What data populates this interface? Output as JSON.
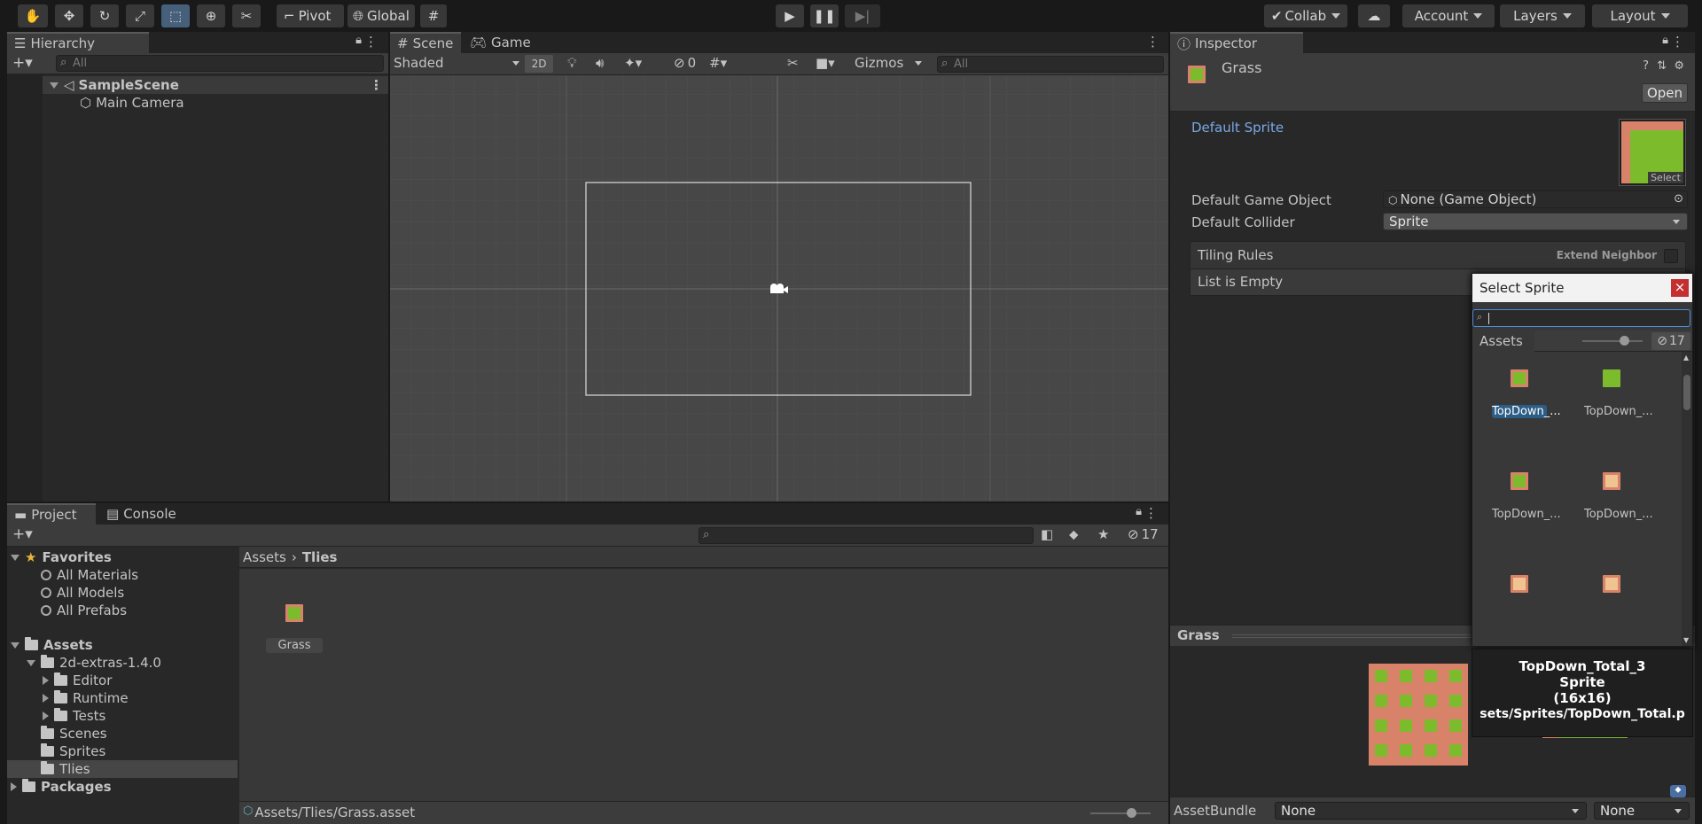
{
  "toolbar": {
    "pivot": "Pivot",
    "global": "Global",
    "collab": "Collab",
    "account": "Account",
    "layers": "Layers",
    "layout": "Layout"
  },
  "hierarchy": {
    "tab": "Hierarchy",
    "search_placeholder": "All",
    "scene": "SampleScene",
    "items": [
      "Main Camera"
    ]
  },
  "scene": {
    "tabs": [
      "Scene",
      "Game"
    ],
    "shading": "Shaded",
    "mode_2d": "2D",
    "hidden_count": "0",
    "gizmos": "Gizmos",
    "search_placeholder": "All"
  },
  "project": {
    "tabs": [
      "Project",
      "Console"
    ],
    "hidden_count": "17",
    "favorites_label": "Favorites",
    "favorites": [
      "All Materials",
      "All Models",
      "All Prefabs"
    ],
    "assets_label": "Assets",
    "tree": [
      {
        "label": "2d-extras-1.4.0",
        "depth": 1
      },
      {
        "label": "Editor",
        "depth": 2
      },
      {
        "label": "Runtime",
        "depth": 2
      },
      {
        "label": "Tests",
        "depth": 2
      },
      {
        "label": "Scenes",
        "depth": 1
      },
      {
        "label": "Sprites",
        "depth": 1
      },
      {
        "label": "Tlies",
        "depth": 1
      }
    ],
    "packages_label": "Packages",
    "breadcrumb": [
      "Assets",
      "Tlies"
    ],
    "grid_items": [
      "Grass"
    ],
    "footer_path": "Assets/Tlies/Grass.asset"
  },
  "inspector": {
    "tab": "Inspector",
    "object_name": "Grass",
    "open_button": "Open",
    "default_sprite": "Default Sprite",
    "select_label": "Select",
    "default_game_object_label": "Default Game Object",
    "default_game_object_value": "None (Game Object)",
    "default_collider_label": "Default Collider",
    "default_collider_value": "Sprite",
    "tiling_rules": "Tiling Rules",
    "extend_neighbor": "Extend Neighbor",
    "list_empty": "List is Empty",
    "preview_title": "Grass",
    "assetbundle_label": "AssetBundle",
    "assetbundle_value": "None",
    "assetbundle_variant": "None"
  },
  "select_sprite": {
    "title": "Select Sprite",
    "close": "×",
    "tab": "Assets",
    "hidden_count": "17",
    "items": [
      "TopDown_...",
      "TopDown_...",
      "TopDown_...",
      "TopDown_...",
      "",
      ""
    ],
    "tooltip_lines": [
      "TopDown_Total_3",
      "Sprite",
      "(16x16)",
      "sets/Sprites/TopDown_Total.p"
    ]
  }
}
